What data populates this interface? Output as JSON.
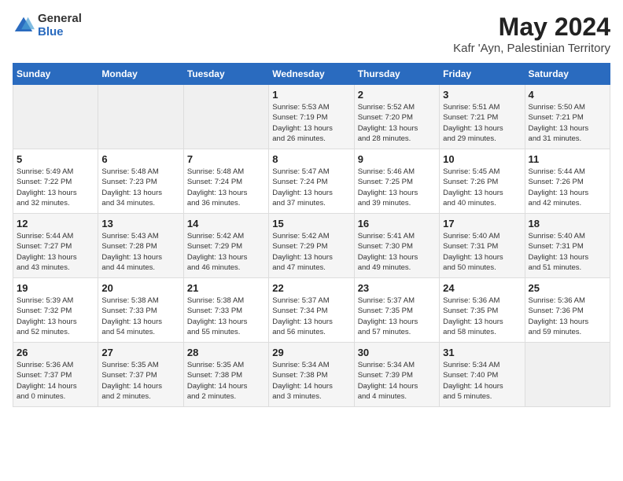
{
  "logo": {
    "general": "General",
    "blue": "Blue"
  },
  "title": "May 2024",
  "subtitle": "Kafr 'Ayn, Palestinian Territory",
  "weekdays": [
    "Sunday",
    "Monday",
    "Tuesday",
    "Wednesday",
    "Thursday",
    "Friday",
    "Saturday"
  ],
  "weeks": [
    [
      {
        "day": "",
        "info": ""
      },
      {
        "day": "",
        "info": ""
      },
      {
        "day": "",
        "info": ""
      },
      {
        "day": "1",
        "info": "Sunrise: 5:53 AM\nSunset: 7:19 PM\nDaylight: 13 hours\nand 26 minutes."
      },
      {
        "day": "2",
        "info": "Sunrise: 5:52 AM\nSunset: 7:20 PM\nDaylight: 13 hours\nand 28 minutes."
      },
      {
        "day": "3",
        "info": "Sunrise: 5:51 AM\nSunset: 7:21 PM\nDaylight: 13 hours\nand 29 minutes."
      },
      {
        "day": "4",
        "info": "Sunrise: 5:50 AM\nSunset: 7:21 PM\nDaylight: 13 hours\nand 31 minutes."
      }
    ],
    [
      {
        "day": "5",
        "info": "Sunrise: 5:49 AM\nSunset: 7:22 PM\nDaylight: 13 hours\nand 32 minutes."
      },
      {
        "day": "6",
        "info": "Sunrise: 5:48 AM\nSunset: 7:23 PM\nDaylight: 13 hours\nand 34 minutes."
      },
      {
        "day": "7",
        "info": "Sunrise: 5:48 AM\nSunset: 7:24 PM\nDaylight: 13 hours\nand 36 minutes."
      },
      {
        "day": "8",
        "info": "Sunrise: 5:47 AM\nSunset: 7:24 PM\nDaylight: 13 hours\nand 37 minutes."
      },
      {
        "day": "9",
        "info": "Sunrise: 5:46 AM\nSunset: 7:25 PM\nDaylight: 13 hours\nand 39 minutes."
      },
      {
        "day": "10",
        "info": "Sunrise: 5:45 AM\nSunset: 7:26 PM\nDaylight: 13 hours\nand 40 minutes."
      },
      {
        "day": "11",
        "info": "Sunrise: 5:44 AM\nSunset: 7:26 PM\nDaylight: 13 hours\nand 42 minutes."
      }
    ],
    [
      {
        "day": "12",
        "info": "Sunrise: 5:44 AM\nSunset: 7:27 PM\nDaylight: 13 hours\nand 43 minutes."
      },
      {
        "day": "13",
        "info": "Sunrise: 5:43 AM\nSunset: 7:28 PM\nDaylight: 13 hours\nand 44 minutes."
      },
      {
        "day": "14",
        "info": "Sunrise: 5:42 AM\nSunset: 7:29 PM\nDaylight: 13 hours\nand 46 minutes."
      },
      {
        "day": "15",
        "info": "Sunrise: 5:42 AM\nSunset: 7:29 PM\nDaylight: 13 hours\nand 47 minutes."
      },
      {
        "day": "16",
        "info": "Sunrise: 5:41 AM\nSunset: 7:30 PM\nDaylight: 13 hours\nand 49 minutes."
      },
      {
        "day": "17",
        "info": "Sunrise: 5:40 AM\nSunset: 7:31 PM\nDaylight: 13 hours\nand 50 minutes."
      },
      {
        "day": "18",
        "info": "Sunrise: 5:40 AM\nSunset: 7:31 PM\nDaylight: 13 hours\nand 51 minutes."
      }
    ],
    [
      {
        "day": "19",
        "info": "Sunrise: 5:39 AM\nSunset: 7:32 PM\nDaylight: 13 hours\nand 52 minutes."
      },
      {
        "day": "20",
        "info": "Sunrise: 5:38 AM\nSunset: 7:33 PM\nDaylight: 13 hours\nand 54 minutes."
      },
      {
        "day": "21",
        "info": "Sunrise: 5:38 AM\nSunset: 7:33 PM\nDaylight: 13 hours\nand 55 minutes."
      },
      {
        "day": "22",
        "info": "Sunrise: 5:37 AM\nSunset: 7:34 PM\nDaylight: 13 hours\nand 56 minutes."
      },
      {
        "day": "23",
        "info": "Sunrise: 5:37 AM\nSunset: 7:35 PM\nDaylight: 13 hours\nand 57 minutes."
      },
      {
        "day": "24",
        "info": "Sunrise: 5:36 AM\nSunset: 7:35 PM\nDaylight: 13 hours\nand 58 minutes."
      },
      {
        "day": "25",
        "info": "Sunrise: 5:36 AM\nSunset: 7:36 PM\nDaylight: 13 hours\nand 59 minutes."
      }
    ],
    [
      {
        "day": "26",
        "info": "Sunrise: 5:36 AM\nSunset: 7:37 PM\nDaylight: 14 hours\nand 0 minutes."
      },
      {
        "day": "27",
        "info": "Sunrise: 5:35 AM\nSunset: 7:37 PM\nDaylight: 14 hours\nand 2 minutes."
      },
      {
        "day": "28",
        "info": "Sunrise: 5:35 AM\nSunset: 7:38 PM\nDaylight: 14 hours\nand 2 minutes."
      },
      {
        "day": "29",
        "info": "Sunrise: 5:34 AM\nSunset: 7:38 PM\nDaylight: 14 hours\nand 3 minutes."
      },
      {
        "day": "30",
        "info": "Sunrise: 5:34 AM\nSunset: 7:39 PM\nDaylight: 14 hours\nand 4 minutes."
      },
      {
        "day": "31",
        "info": "Sunrise: 5:34 AM\nSunset: 7:40 PM\nDaylight: 14 hours\nand 5 minutes."
      },
      {
        "day": "",
        "info": ""
      }
    ]
  ]
}
